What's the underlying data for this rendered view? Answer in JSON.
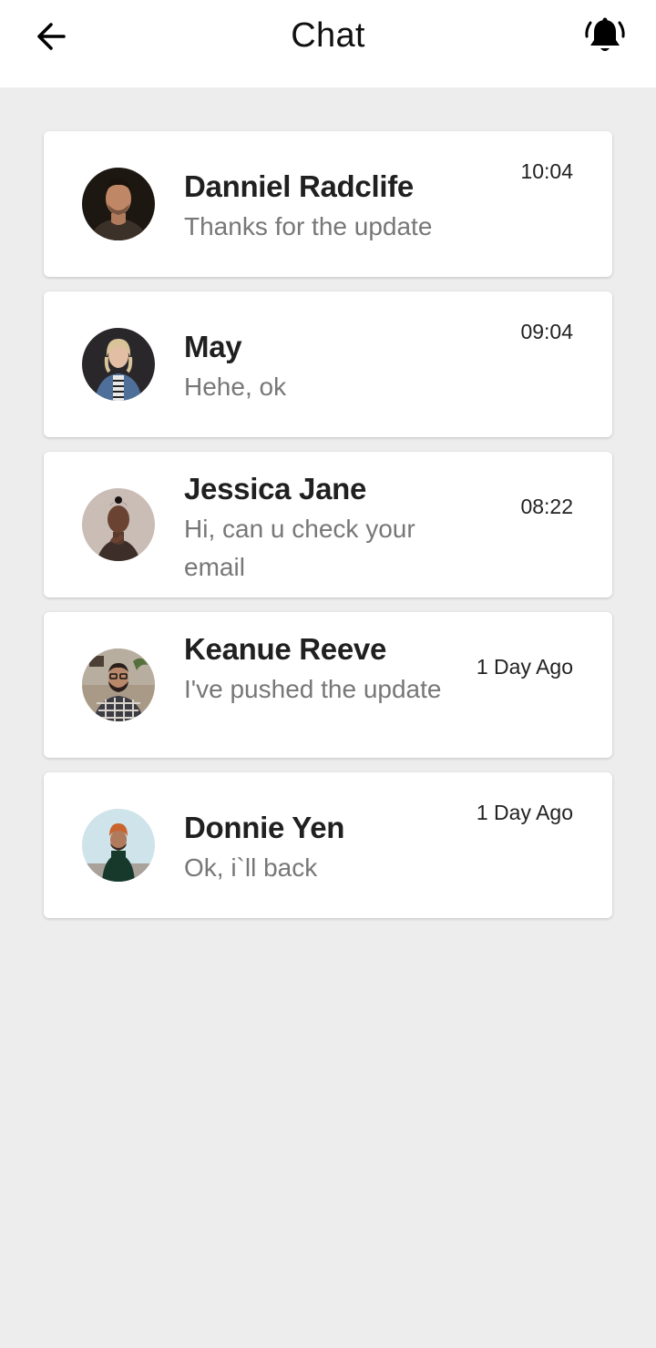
{
  "header": {
    "title": "Chat",
    "back_icon": "arrow-left-icon",
    "notification_icon": "bell-ring-icon"
  },
  "chats": [
    {
      "name": "Danniel Radclife",
      "message": "Thanks for the update",
      "time": "10:04"
    },
    {
      "name": "May",
      "message": "Hehe, ok",
      "time": "09:04"
    },
    {
      "name": "Jessica Jane",
      "message": "Hi, can u check your email",
      "time": "08:22"
    },
    {
      "name": "Keanue Reeve",
      "message": "I've pushed the update",
      "time": "1 Day Ago"
    },
    {
      "name": "Donnie Yen",
      "message": "Ok, i`ll back",
      "time": "1 Day Ago"
    }
  ]
}
